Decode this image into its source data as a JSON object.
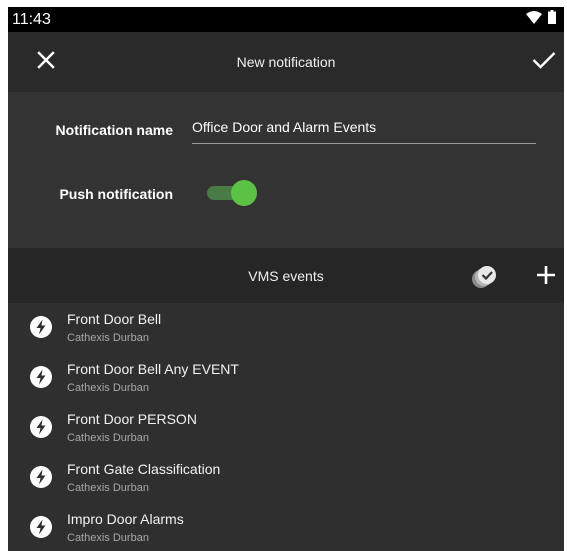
{
  "status_bar": {
    "time": "11:43",
    "icons": [
      "wifi-icon",
      "battery-icon"
    ]
  },
  "app_bar": {
    "title": "New notification",
    "close_icon": "close-icon",
    "confirm_icon": "check-icon"
  },
  "form": {
    "name_label": "Notification name",
    "name_value": "Office Door and Alarm Events",
    "push_label": "Push notification",
    "push_enabled": true
  },
  "events_section": {
    "title": "VMS events",
    "select_all_icon": "check-all-icon",
    "add_icon": "plus-icon"
  },
  "events": [
    {
      "title": "Front Door Bell",
      "subtitle": "Cathexis Durban",
      "icon": "lightning-icon"
    },
    {
      "title": "Front Door Bell Any EVENT",
      "subtitle": "Cathexis Durban",
      "icon": "lightning-icon"
    },
    {
      "title": "Front Door PERSON",
      "subtitle": "Cathexis Durban",
      "icon": "lightning-icon"
    },
    {
      "title": "Front Gate Classification",
      "subtitle": "Cathexis Durban",
      "icon": "lightning-icon"
    },
    {
      "title": "Impro Door Alarms",
      "subtitle": "Cathexis Durban",
      "icon": "lightning-icon"
    }
  ],
  "colors": {
    "accent_green": "#5cc245",
    "background": "#2d2d2d",
    "status_bar": "#000000"
  }
}
